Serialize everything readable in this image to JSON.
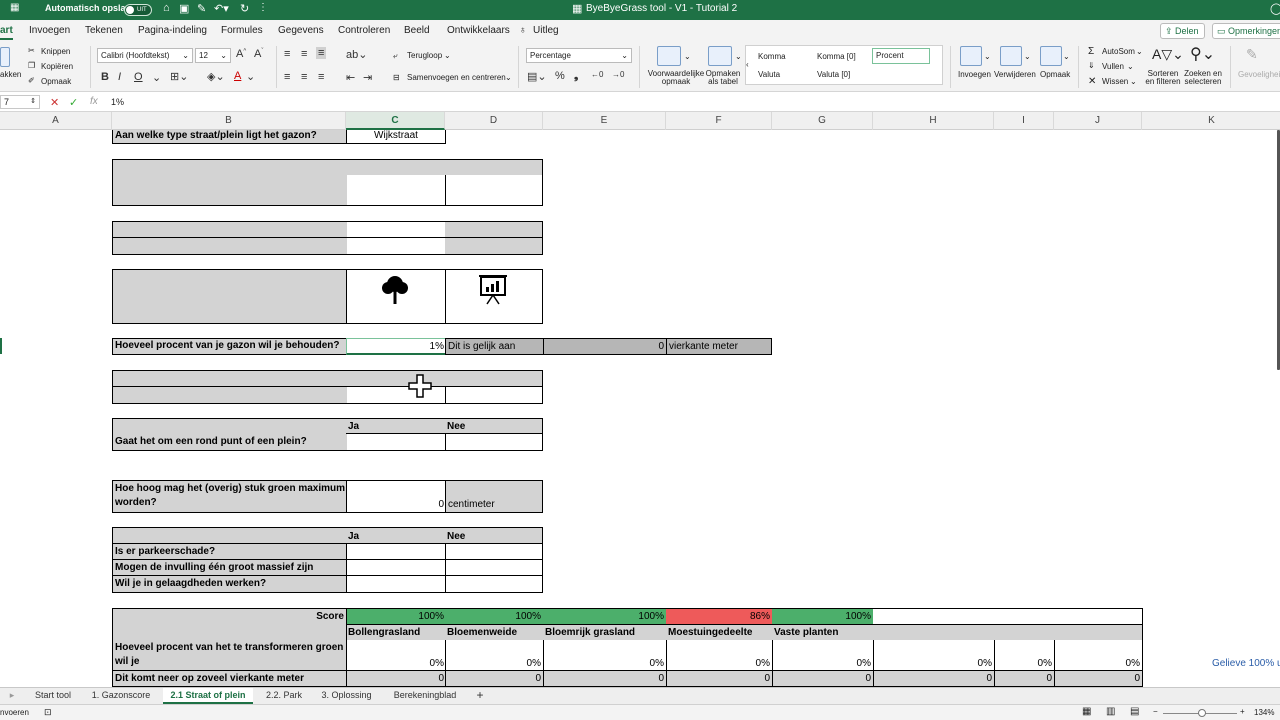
{
  "titlebar": {
    "autosave_label": "Automatisch opslaan",
    "autosave_state": "UIT",
    "title": "ByeByeGrass tool - V1 - Tutorial 2"
  },
  "ribbon_tabs": [
    "art",
    "Invoegen",
    "Tekenen",
    "Pagina-indeling",
    "Formules",
    "Gegevens",
    "Controleren",
    "Beeld",
    "Ontwikkelaars",
    "Uitleg"
  ],
  "share_label": "Delen",
  "comments_label": "Opmerkingen",
  "ribbon": {
    "paste": "akken",
    "cut": "Knippen",
    "copy": "Kopiëren",
    "format": "Opmaak",
    "font": "Calibri (Hoofdtekst)",
    "size": "12",
    "wrap": "Terugloop",
    "merge": "Samenvoegen en centreren",
    "number_format": "Percentage",
    "cond_format": [
      "Voorwaardelijke",
      "opmaak"
    ],
    "table_format": [
      "Opmaken",
      "als tabel"
    ],
    "styles": {
      "komma": "Komma",
      "komma0": "Komma [0]",
      "procent": "Procent",
      "valuta": "Valuta",
      "valuta0": "Valuta [0]"
    },
    "insert": "Invoegen",
    "delete": "Verwijderen",
    "cell_format": "Opmaak",
    "autosum": "AutoSom",
    "fill": "Vullen",
    "clear": "Wissen",
    "sort": [
      "Sorteren",
      "en filteren"
    ],
    "find": [
      "Zoeken en",
      "selecteren"
    ],
    "sensitivity": "Gevoeligheid"
  },
  "formulabar": {
    "namebox": "7",
    "formula": "1%"
  },
  "columns": [
    "A",
    "B",
    "C",
    "D",
    "E",
    "F",
    "G",
    "H",
    "I",
    "J",
    "K"
  ],
  "sheet": {
    "q_type_straat": "Aan welke type straat/plein ligt het gazon?",
    "type_straat_value": "Wijkstraat",
    "q_procent": "Hoeveel procent van je gazon wil je behouden?",
    "procent_value": "1%",
    "gelijk_aan": "Dit is gelijk aan",
    "m2_value": "0",
    "m2_unit": "vierkante meter",
    "ja": "Ja",
    "nee": "Nee",
    "q_rond_punt": "Gaat het om een rond punt of een plein?",
    "q_hoogte_1": "Hoe hoog mag het (overig) stuk groen maximum",
    "q_hoogte_2": "worden?",
    "hoogte_value": "0",
    "hoogte_unit": "centimeter",
    "q_parkeer": "Is er parkeerschade?",
    "q_massief": "Mogen de invulling één groot massief zijn",
    "q_gelaagd": "Wil je in gelaagdheden werken?",
    "score_label": "Score",
    "score_values": [
      "100%",
      "100%",
      "100%",
      "86%",
      "100%"
    ],
    "categories": [
      "Bollengrasland",
      "Bloemenweide",
      "Bloemrijk grasland",
      "Moestuingedeelte",
      "Vaste planten"
    ],
    "q_transform_1": "Hoeveel procent van het te transformeren groen",
    "q_transform_2": "wil je",
    "transform_values": [
      "0%",
      "0%",
      "0%",
      "0%",
      "0%",
      "0%",
      "0%",
      "0%"
    ],
    "m2_row_label": "Dit komt neer op zoveel vierkante meter",
    "m2_row_values": [
      "0",
      "0",
      "0",
      "0",
      "0",
      "0",
      "0",
      "0"
    ],
    "note": "Gelieve 100% u"
  },
  "sheet_tabs": [
    "Start tool",
    "1. Gazonscore",
    "2.1 Straat of plein",
    "2.2. Park",
    "3. Oplossing",
    "Berekeningblad"
  ],
  "active_sheet": "2.1 Straat of plein",
  "status": {
    "mode": "nvoeren",
    "zoom": "134%"
  }
}
